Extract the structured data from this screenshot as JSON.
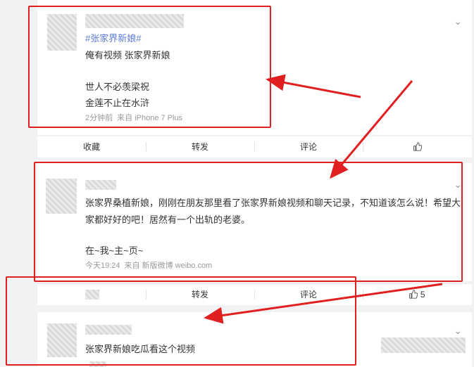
{
  "post1": {
    "hashtag": "#张家界新娘#",
    "line1": "俺有视频 张家界新娘",
    "line2": "世人不必羡梁祝",
    "line3": "金莲不止在水浒",
    "time": "2分钟前",
    "source": "来自 iPhone 7 Plus"
  },
  "actions1": {
    "fav": "收藏",
    "repost": "转发",
    "comment": "评论"
  },
  "post2": {
    "text_a": "张家界桑植新娘，刚刚在朋友那里看了张家界新娘视频和聊天记录，不知道该怎么说！希望大",
    "text_b": "家都好好的吧！居然有一个出轨的老婆。",
    "signoff": "在~我~主~页~",
    "time": "今天19:24",
    "source": "来自 新版微博 weibo.com"
  },
  "actions2": {
    "repost": "转发",
    "comment": "评论",
    "likes": "5"
  },
  "post3": {
    "text": "张家界新娘吃瓜看这个视频"
  },
  "icons": {
    "chevron": "chevron-down-icon",
    "like": "thumbs-up-icon"
  },
  "colors": {
    "highlight": "#e02020",
    "link": "#5b7bd5"
  }
}
